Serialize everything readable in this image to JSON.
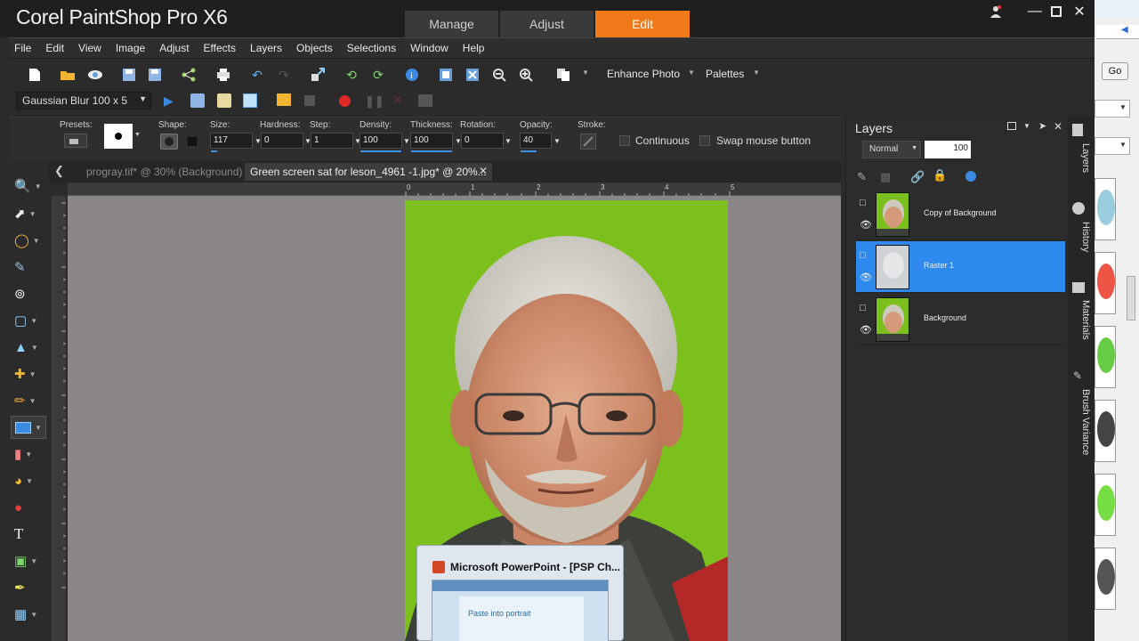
{
  "title_bar": {
    "app_title": "Corel PaintShop Pro X6",
    "workspace_tabs": [
      "Manage",
      "Adjust",
      "Edit"
    ],
    "active_tab": "Edit"
  },
  "menu": [
    "File",
    "Edit",
    "View",
    "Image",
    "Adjust",
    "Effects",
    "Layers",
    "Objects",
    "Selections",
    "Window",
    "Help"
  ],
  "toolbar": {
    "enhance_photo": "Enhance Photo",
    "palettes": "Palettes",
    "preset_script": "Gaussian Blur 100 x 5"
  },
  "tool_options": {
    "presets_label": "Presets:",
    "shape_label": "Shape:",
    "size_label": "Size:",
    "size_value": "117",
    "hardness_label": "Hardness:",
    "hardness_value": "0",
    "step_label": "Step:",
    "step_value": "1",
    "density_label": "Density:",
    "density_value": "100",
    "thickness_label": "Thickness:",
    "thickness_value": "100",
    "rotation_label": "Rotation:",
    "rotation_value": "0",
    "opacity_label": "Opacity:",
    "opacity_value": "40",
    "stroke_label": "Stroke:",
    "continuous": "Continuous",
    "swap_mouse": "Swap mouse button"
  },
  "doc_tabs": [
    {
      "label": "progray.tif* @  30% (Background)",
      "active": false
    },
    {
      "label": "Green screen sat for leson_4961 -1.jpg* @  20%...",
      "active": true
    }
  ],
  "ruler": {
    "marks": [
      "0",
      "1",
      "2",
      "3",
      "4",
      "5"
    ]
  },
  "layers_panel": {
    "title": "Layers",
    "blend_mode": "Normal",
    "opacity": "100",
    "layers": [
      {
        "name": "Copy of Background",
        "selected": false,
        "thumb": "photo"
      },
      {
        "name": "Raster 1",
        "selected": true,
        "thumb": "gray"
      },
      {
        "name": "Background",
        "selected": false,
        "thumb": "photo"
      }
    ]
  },
  "side_tabs": [
    "Layers",
    "History",
    "Materials",
    "Brush Variance"
  ],
  "taskbar_preview": {
    "title": "Microsoft PowerPoint - [PSP Ch...",
    "slide_text": "Paste into portrait"
  },
  "browser": {
    "go": "Go"
  },
  "colors": {
    "accent_orange": "#f07a1a",
    "selection_blue": "#2f8af0",
    "green_screen": "#7cc01e"
  }
}
